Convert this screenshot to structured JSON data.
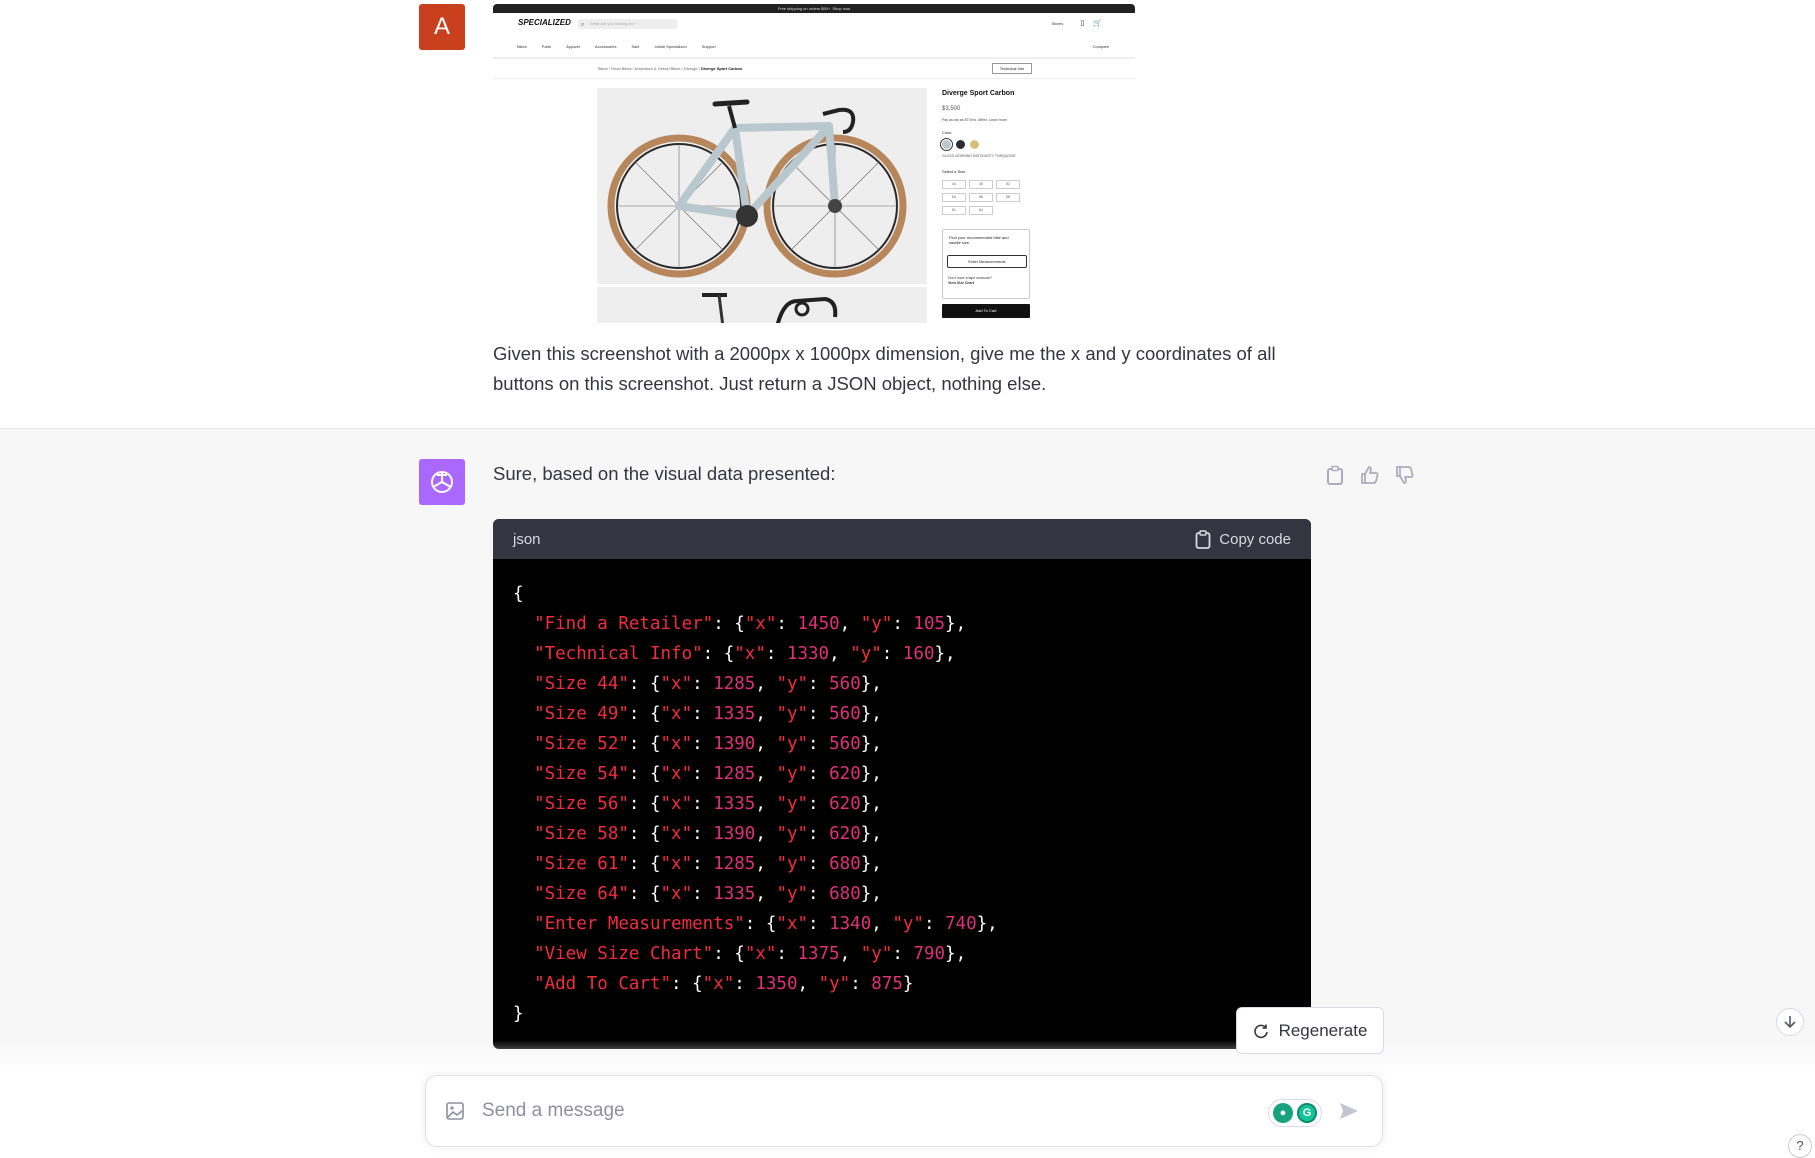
{
  "user_message": {
    "avatar_letter": "A",
    "text": "Given this screenshot with a 2000px x 1000px dimension, give me the x and y coordinates of all buttons on this screenshot. Just return a JSON object, nothing else.",
    "screenshot": {
      "top_banner": "Free shipping on orders $50+. Shop now",
      "brand": "SPECIALIZED",
      "search_placeholder": "What are you looking for?",
      "find_retailer": "Stores",
      "nav": [
        "Bikes",
        "Parts",
        "Apparel",
        "Accessories",
        "Sale",
        "Inside Specialized",
        "Support"
      ],
      "compare": "Compare",
      "breadcrumb_prefix": "Bikes / Road Bikes / Adventure & Gravel Bikes / Diverge / ",
      "breadcrumb_current": "Diverge Sport Carbon",
      "technical_info": "Technical Info",
      "product_title": "Diverge Sport Carbon",
      "price": "$3,500",
      "affirm_text": "Pay as low as $77/mo. Affirm. Learn more",
      "color_label": "Color",
      "color_name": "GLOSS MORNING MIST/DUSTY TURQUOISE",
      "swatch_colors": [
        "#b9c8cf",
        "#2a2d31",
        "#d8c07a"
      ],
      "size_label": "Select a Size",
      "sizes": [
        "44",
        "49",
        "52",
        "54",
        "56",
        "58",
        "61",
        "64"
      ],
      "fit_text": "Find your recommended bike and saddle size",
      "enter_measurements": "Enter Measurements",
      "tape_text": "Don't have a tape measure?",
      "view_size_chart": "View Size Chart",
      "add_to_cart": "Add To Cart"
    }
  },
  "assistant_message": {
    "intro": "Sure, based on the visual data presented:",
    "code_language": "json",
    "copy_label": "Copy code",
    "entries": [
      {
        "key": "Find a Retailer",
        "x": "1450",
        "y": "105"
      },
      {
        "key": "Technical Info",
        "x": "1330",
        "y": "160"
      },
      {
        "key": "Size 44",
        "x": "1285",
        "y": "560"
      },
      {
        "key": "Size 49",
        "x": "1335",
        "y": "560"
      },
      {
        "key": "Size 52",
        "x": "1390",
        "y": "560"
      },
      {
        "key": "Size 54",
        "x": "1285",
        "y": "620"
      },
      {
        "key": "Size 56",
        "x": "1335",
        "y": "620"
      },
      {
        "key": "Size 58",
        "x": "1390",
        "y": "620"
      },
      {
        "key": "Size 61",
        "x": "1285",
        "y": "680"
      },
      {
        "key": "Size 64",
        "x": "1335",
        "y": "680"
      },
      {
        "key": "Enter Measurements",
        "x": "1340",
        "y": "740"
      },
      {
        "key": "View Size Chart",
        "x": "1375",
        "y": "790"
      },
      {
        "key": "Add To Cart",
        "x": "1350",
        "y": "875"
      }
    ]
  },
  "controls": {
    "regenerate": "Regenerate",
    "composer_placeholder": "Send a message",
    "help": "?"
  },
  "colors": {
    "user_avatar": "#c8401e",
    "assistant_avatar": "#ab68ff",
    "json_key": "#f22c3d",
    "json_number": "#df3079"
  }
}
